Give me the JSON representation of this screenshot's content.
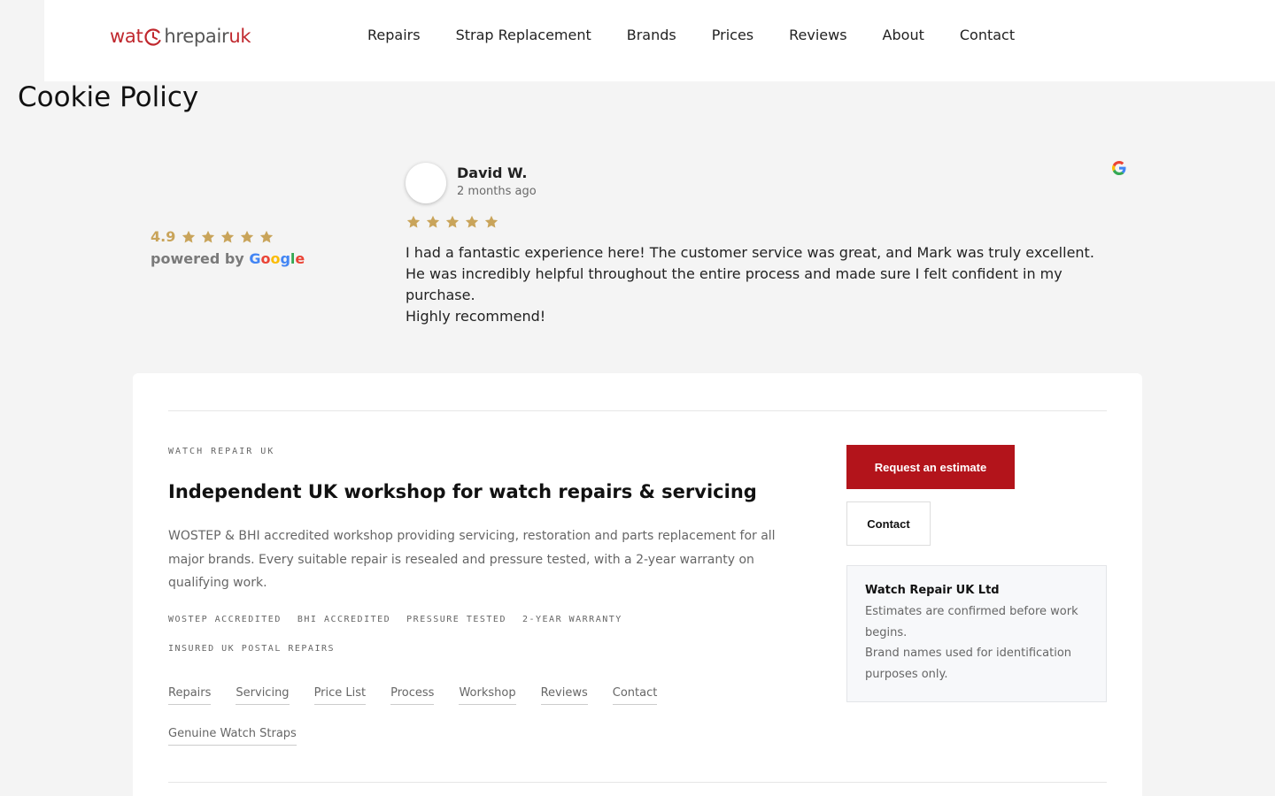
{
  "header": {
    "logo": {
      "part1": "wat",
      "part2": "hrepair",
      "part3": "uk"
    },
    "nav": [
      "Repairs",
      "Strap Replacement",
      "Brands",
      "Prices",
      "Reviews",
      "About",
      "Contact"
    ]
  },
  "page_title": "Cookie Policy",
  "reviews_widget": {
    "rating": "4.9",
    "rating_stars": 5,
    "powered_by": "powered by",
    "google_letters": [
      "G",
      "o",
      "o",
      "g",
      "l",
      "e"
    ],
    "review": {
      "name": "David W.",
      "date": "2 months ago",
      "stars": 5,
      "text": "I had a fantastic experience here! The customer service was great, and Mark was truly excellent. He was incredibly helpful throughout the entire process and made sure I felt confident in my purchase.\nHighly recommend!"
    }
  },
  "footer_card": {
    "eyebrow": "WATCH REPAIR UK",
    "title": "Independent UK workshop for watch repairs & servicing",
    "description": "WOSTEP & BHI accredited workshop providing servicing, restoration and parts replacement for all major brands. Every suitable repair is resealed and pressure tested, with a 2-year warranty on qualifying work.",
    "tags": [
      "WOSTEP ACCREDITED",
      "BHI ACCREDITED",
      "PRESSURE TESTED",
      "2-YEAR WARRANTY",
      "INSURED UK POSTAL REPAIRS"
    ],
    "links": [
      "Repairs",
      "Servicing",
      "Price List",
      "Process",
      "Workshop",
      "Reviews",
      "Contact",
      "Genuine Watch Straps"
    ],
    "primary_button": "Request an estimate",
    "secondary_button": "Contact",
    "info": {
      "title": "Watch Repair UK Ltd",
      "line1": "Estimates are confirmed before work begins.",
      "line2": "Brand names used for identification purposes only."
    }
  },
  "colors": {
    "brand_red": "#b3141b",
    "star_gold": "#c9a45a",
    "background": "#f4f4f4"
  },
  "icons": [
    "clock-logo-icon",
    "star-icon",
    "google-icon"
  ]
}
